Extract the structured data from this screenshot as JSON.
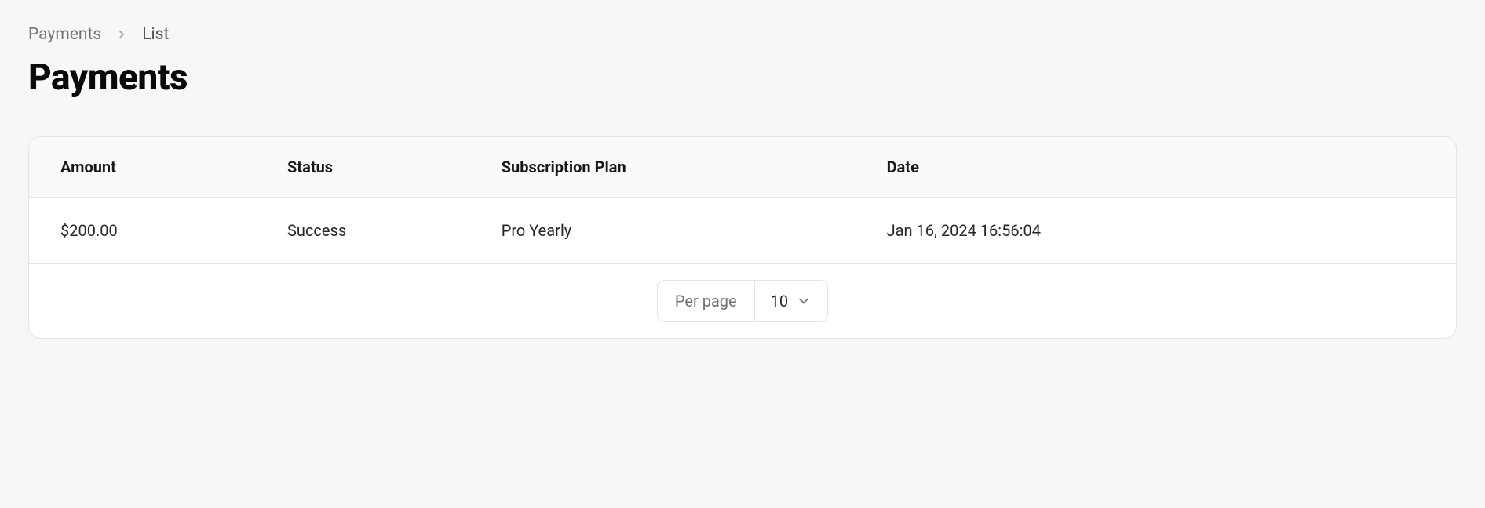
{
  "breadcrumb": {
    "root": "Payments",
    "current": "List"
  },
  "page": {
    "title": "Payments"
  },
  "table": {
    "headers": {
      "amount": "Amount",
      "status": "Status",
      "plan": "Subscription Plan",
      "date": "Date"
    },
    "rows": [
      {
        "amount": "$200.00",
        "status": "Success",
        "plan": "Pro Yearly",
        "date": "Jan 16, 2024 16:56:04"
      }
    ]
  },
  "pagination": {
    "per_page_label": "Per page",
    "per_page_value": "10"
  }
}
